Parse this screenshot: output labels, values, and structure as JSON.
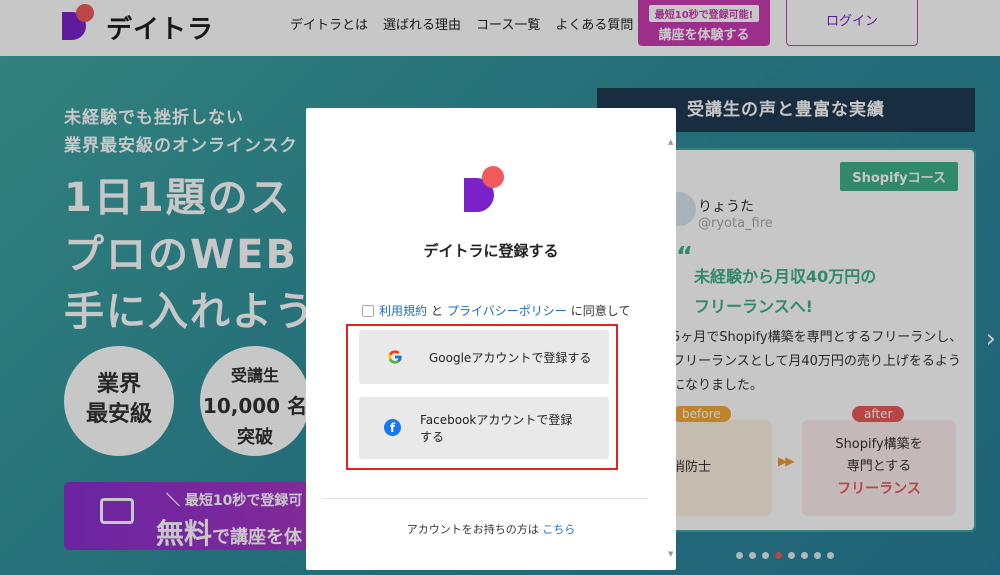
{
  "header": {
    "brand": "デイトラ",
    "nav": [
      "デイトラとは",
      "選ばれる理由",
      "コース一覧",
      "よくある質問"
    ],
    "trial_badge": "最短10秒で登録可能!",
    "trial_label": "講座を体験する",
    "login_label": "ログイン"
  },
  "hero": {
    "sub_line1": "未経験でも挫折しない",
    "sub_line2": "業界最安級のオンラインスク",
    "title_line1": "1日1題のス",
    "title_line2": "プロのWEB",
    "title_line3": "手に入れよう",
    "circle1_line1": "業界",
    "circle1_line2": "最安級",
    "circle2_line1": "受講生",
    "circle2_line2": "10,000 名",
    "circle2_line3": "突破",
    "cta_small": "＼ 最短10秒で登録可",
    "cta_big": "無料",
    "cta_rest": "で講座を体"
  },
  "voices": {
    "section_title": "受講生の声と豊富な実績",
    "course_tag": "Shopifyコース",
    "user_name": "りょうた",
    "user_handle": "@ryota_fire",
    "quote_mark": "“",
    "headline": "未経験から月収40万円の\nフリーランスへ!",
    "description": "5ヶ月でShopify構築を専門とするフリーランし、フリーランスとして月40万円の売り上げをるようになりました。",
    "before_tag": "before",
    "before_text": "消防士",
    "arrows": "▶▶",
    "after_tag": "after",
    "after_line1": "Shopify構築を",
    "after_line2": "専門とする",
    "after_line3": "フリーランス",
    "next_arrow": "›"
  },
  "modal": {
    "title": "デイトラに登録する",
    "terms_link": "利用規約",
    "and": "と",
    "privacy_link": "プライバシーポリシー",
    "agree_suffix": "に同意して",
    "google_label": "Googleアカウントで登録する",
    "facebook_label": "Facebookアカウントで登録する",
    "facebook_icon_glyph": "f",
    "have_account_text": "アカウントをお持ちの方は",
    "here_link": "こちら"
  },
  "colors": {
    "brand_purple": "#7b22c9",
    "brand_coral": "#f05a5a",
    "trial_pink": "#c93db3",
    "hero_teal": "#3fa6a0",
    "link_blue": "#1a6fc4",
    "highlight_red": "#e02424",
    "facebook_blue": "#1877f2"
  },
  "icons": {
    "google": "google-g-icon",
    "facebook": "facebook-f-icon",
    "video": "video-camera-icon",
    "next": "chevron-right-icon"
  }
}
